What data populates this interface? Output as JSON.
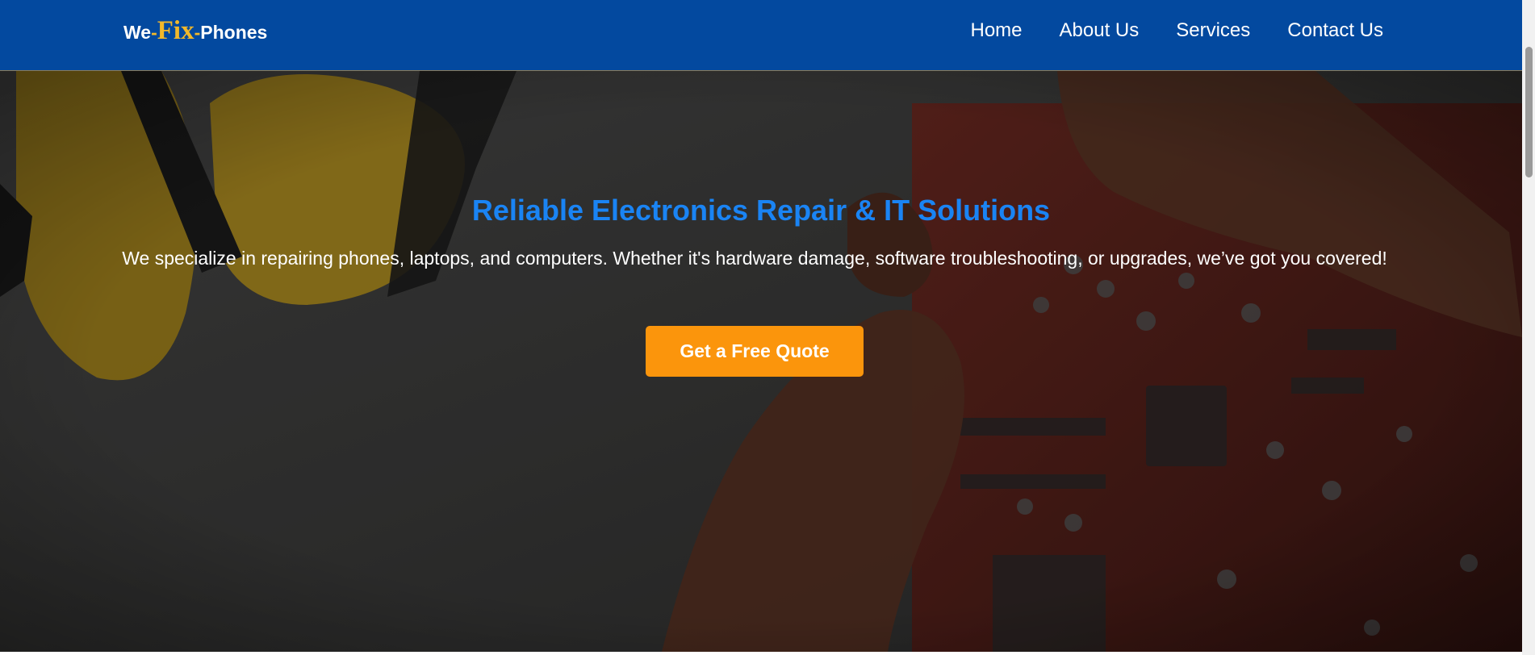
{
  "header": {
    "logo": {
      "part1": "We",
      "dash1": "-",
      "accent": "Fix",
      "dash2": "-",
      "part2": "Phones"
    },
    "nav": [
      "Home",
      "About Us",
      "Services",
      "Contact Us"
    ]
  },
  "hero": {
    "title": "Reliable Electronics Repair & IT Solutions",
    "text": "We specialize in repairing phones, laptops, and computers. Whether it's hardware damage, software troubleshooting, or upgrades, we’ve got you covered!",
    "button": "Get a Free Quote"
  },
  "colors": {
    "navbar": "#03499f",
    "logo_accent": "#f2b82a",
    "hero_title": "#1a84f4",
    "button": "#fb950c"
  }
}
